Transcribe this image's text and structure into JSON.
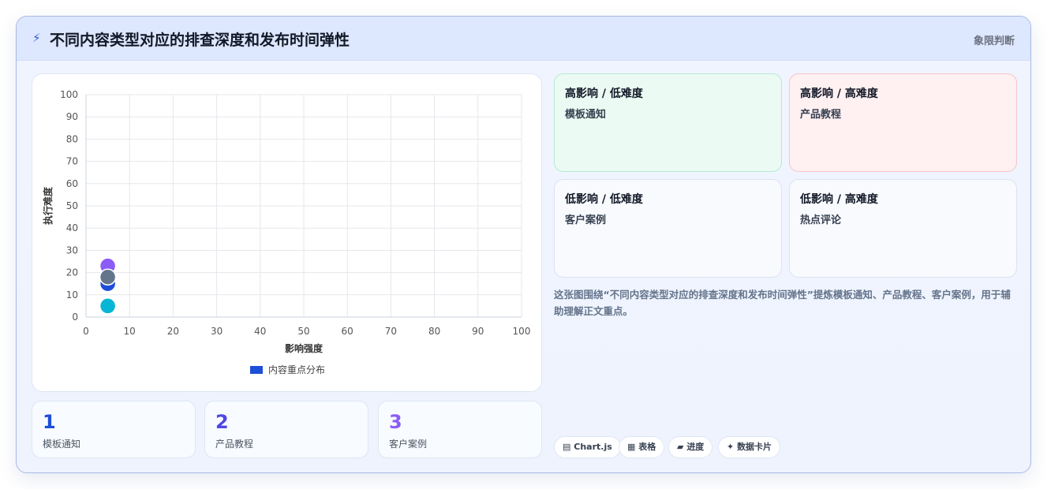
{
  "header": {
    "icon": "bolt-icon",
    "title": "不同内容类型对应的排查深度和发布时间弹性",
    "tag": "象限判断"
  },
  "chart_data": {
    "type": "scatter",
    "xlabel": "影响强度",
    "ylabel": "执行难度",
    "xlim": [
      0,
      100
    ],
    "ylim": [
      0,
      100
    ],
    "ticks": [
      "0",
      "10",
      "20",
      "30",
      "40",
      "50",
      "60",
      "70",
      "80",
      "90",
      "100"
    ],
    "grid": true,
    "legend_position": "bottom",
    "legend_color": "#1d4ed8",
    "series": [
      {
        "name": "内容重点分布",
        "points": [
          {
            "x": 5,
            "y": 23,
            "color": "#8b5cf6"
          },
          {
            "x": 5,
            "y": 15,
            "color": "#1d4ed8"
          },
          {
            "x": 5,
            "y": 18,
            "color": "#64748b"
          },
          {
            "x": 5,
            "y": 5,
            "color": "#06b6d4"
          }
        ]
      }
    ]
  },
  "stats": [
    {
      "value": "1",
      "label": "模板通知",
      "color": "#1d4ed8"
    },
    {
      "value": "2",
      "label": "产品教程",
      "color": "#4f46e5"
    },
    {
      "value": "3",
      "label": "客户案例",
      "color": "#8b5cf6"
    }
  ],
  "quadrants": [
    {
      "title": "高影响 / 低难度",
      "item": "模板通知",
      "bg": "#ebfbf3",
      "border": "#b6ead0"
    },
    {
      "title": "高影响 / 高难度",
      "item": "产品教程",
      "bg": "#fff0f1",
      "border": "#f5c6cc"
    },
    {
      "title": "低影响 / 低难度",
      "item": "客户案例",
      "bg": "#f8fafd",
      "border": "#dbe3f3"
    },
    {
      "title": "低影响 / 高难度",
      "item": "热点评论",
      "bg": "#f8fafd",
      "border": "#dbe3f3"
    }
  ],
  "description": "这张图围绕“不同内容类型对应的排查深度和发布时间弹性”提炼模板通知、产品教程、客户案例，用于辅助理解正文重点。",
  "chips": [
    {
      "icon": "chart-icon",
      "glyph": "▤",
      "label": "Chart.js"
    },
    {
      "icon": "table-icon",
      "glyph": "▦",
      "label": "表格"
    },
    {
      "icon": "progress-icon",
      "glyph": "▰",
      "label": "进度"
    },
    {
      "icon": "sparkle-icon",
      "glyph": "✦",
      "label": "数据卡片"
    }
  ]
}
